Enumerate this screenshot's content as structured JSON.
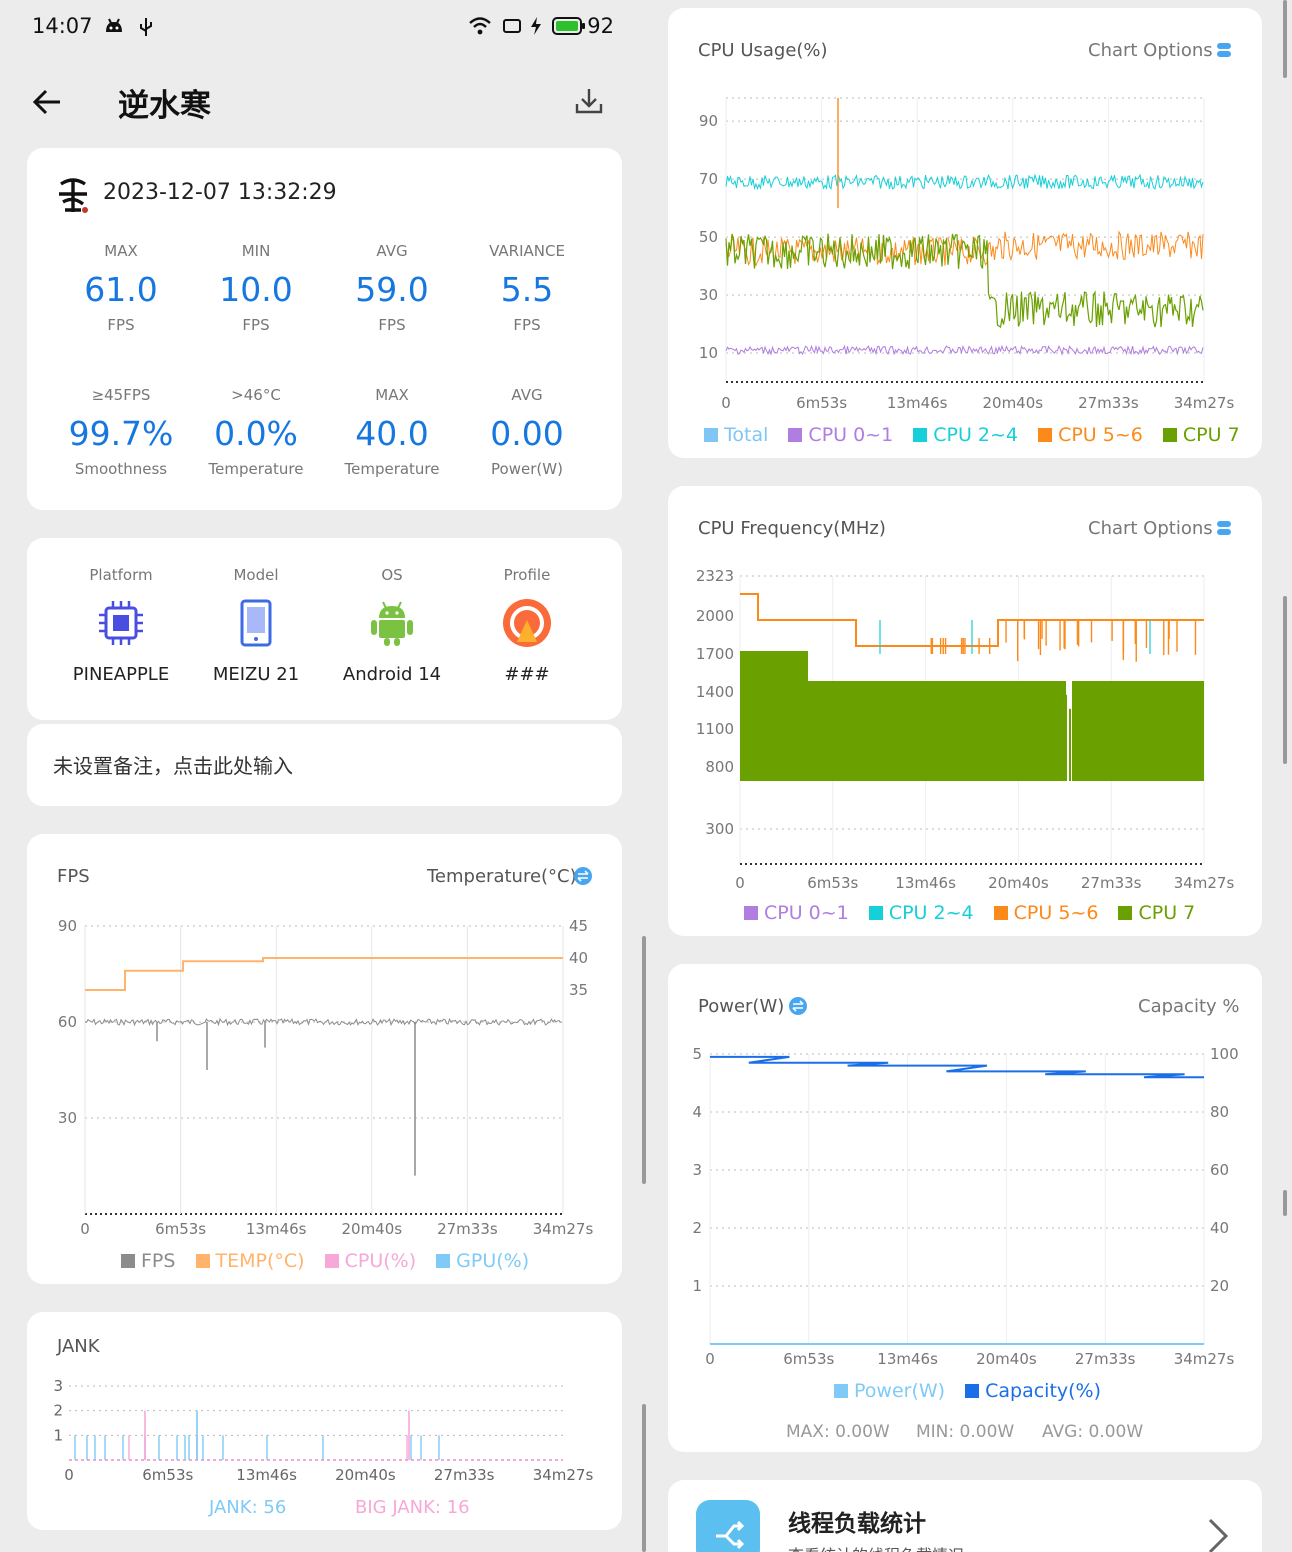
{
  "status_bar": {
    "time": "14:07",
    "battery": "92"
  },
  "header": {
    "title": "逆水寒"
  },
  "summary": {
    "datetime": "2023-12-07 13:32:29",
    "stats": [
      {
        "label": "MAX",
        "value": "61.0",
        "unit": "FPS"
      },
      {
        "label": "MIN",
        "value": "10.0",
        "unit": "FPS"
      },
      {
        "label": "AVG",
        "value": "59.0",
        "unit": "FPS"
      },
      {
        "label": "VARIANCE",
        "value": "5.5",
        "unit": "FPS"
      },
      {
        "label": "≥45FPS",
        "value": "99.7%",
        "unit": "Smoothness"
      },
      {
        "label": ">46°C",
        "value": "0.0%",
        "unit": "Temperature"
      },
      {
        "label": "MAX",
        "value": "40.0",
        "unit": "Temperature"
      },
      {
        "label": "AVG",
        "value": "0.00",
        "unit": "Power(W)"
      }
    ]
  },
  "device": {
    "items": [
      {
        "label": "Platform",
        "name": "PINEAPPLE",
        "icon": "chip-icon"
      },
      {
        "label": "Model",
        "name": "MEIZU 21",
        "icon": "phone-icon"
      },
      {
        "label": "OS",
        "name": "Android 14",
        "icon": "android-icon"
      },
      {
        "label": "Profile",
        "name": "###",
        "icon": "profile-icon"
      }
    ]
  },
  "note": {
    "text": "未设置备注，点击此处输入"
  },
  "fps_chart": {
    "left_title": "FPS",
    "right_title": "Temperature(°C)",
    "y_ticks": [
      "90",
      "60",
      "30"
    ],
    "y2_ticks": [
      "45",
      "40",
      "35"
    ],
    "x_ticks": [
      "0",
      "6m53s",
      "13m46s",
      "20m40s",
      "27m33s",
      "34m27s"
    ],
    "legend": [
      {
        "label": "FPS",
        "color": "#8c8c8c"
      },
      {
        "label": "TEMP(°C)",
        "color": "#ffb36b"
      },
      {
        "label": "CPU(%)",
        "color": "#f7a8d8"
      },
      {
        "label": "GPU(%)",
        "color": "#7fcaf7"
      }
    ]
  },
  "jank_chart": {
    "title": "JANK",
    "y_ticks": [
      "3",
      "2",
      "1"
    ],
    "x_ticks": [
      "0",
      "6m53s",
      "13m46s",
      "20m40s",
      "27m33s",
      "34m27s"
    ],
    "jank_label": "JANK: 56",
    "big_jank_label": "BIG JANK: 16"
  },
  "cpu_usage": {
    "title": "CPU Usage(%)",
    "options": "Chart Options",
    "y_ticks": [
      "90",
      "70",
      "50",
      "30",
      "10"
    ],
    "x_ticks": [
      "0",
      "6m53s",
      "13m46s",
      "20m40s",
      "27m33s",
      "34m27s"
    ],
    "legend": [
      {
        "label": "Total",
        "color": "#7fc6f5"
      },
      {
        "label": "CPU 0~1",
        "color": "#b07de0"
      },
      {
        "label": "CPU 2~4",
        "color": "#16cfd8"
      },
      {
        "label": "CPU 5~6",
        "color": "#fb8a1a"
      },
      {
        "label": "CPU 7",
        "color": "#6aa000"
      }
    ]
  },
  "cpu_freq": {
    "title": "CPU Frequency(MHz)",
    "options": "Chart Options",
    "y_ticks": [
      "2323",
      "2000",
      "1700",
      "1400",
      "1100",
      "800",
      "300"
    ],
    "x_ticks": [
      "0",
      "6m53s",
      "13m46s",
      "20m40s",
      "27m33s",
      "34m27s"
    ],
    "legend": [
      {
        "label": "CPU 0~1",
        "color": "#b07de0"
      },
      {
        "label": "CPU 2~4",
        "color": "#16cfd8"
      },
      {
        "label": "CPU 5~6",
        "color": "#fb8a1a"
      },
      {
        "label": "CPU 7",
        "color": "#6aa000"
      }
    ]
  },
  "power": {
    "title": "Power(W)",
    "right_title": "Capacity %",
    "y_ticks": [
      "5",
      "4",
      "3",
      "2",
      "1"
    ],
    "y2_ticks": [
      "100",
      "80",
      "60",
      "40",
      "20"
    ],
    "x_ticks": [
      "0",
      "6m53s",
      "13m46s",
      "20m40s",
      "27m33s",
      "34m27s"
    ],
    "legend": [
      {
        "label": "Power(W)",
        "color": "#7fcaf7"
      },
      {
        "label": "Capacity(%)",
        "color": "#1a6fe8"
      }
    ],
    "max": "MAX: 0.00W",
    "min": "MIN: 0.00W",
    "avg": "AVG: 0.00W"
  },
  "thread": {
    "title": "线程负载统计",
    "subtitle": "查看统计的线程负载情况"
  },
  "chart_data": [
    {
      "type": "line",
      "title": "FPS",
      "x": [
        "0",
        "6m53s",
        "13m46s",
        "20m40s",
        "27m33s",
        "34m27s"
      ],
      "series": [
        {
          "name": "FPS",
          "values": [
            60,
            59,
            60,
            60,
            60,
            60
          ]
        },
        {
          "name": "TEMP(°C)",
          "values": [
            35,
            38,
            40,
            40,
            40,
            40
          ]
        }
      ],
      "ylim": [
        0,
        90
      ],
      "y2lim": [
        30,
        45
      ]
    },
    {
      "type": "bar",
      "title": "JANK",
      "ylim": [
        0,
        3
      ]
    },
    {
      "type": "line",
      "title": "CPU Usage(%)",
      "x": [
        "0",
        "6m53s",
        "13m46s",
        "20m40s",
        "27m33s",
        "34m27s"
      ],
      "series": [
        {
          "name": "CPU 0~1",
          "values": [
            12,
            12,
            11,
            11,
            11,
            11
          ]
        },
        {
          "name": "CPU 2~4",
          "values": [
            68,
            70,
            69,
            68,
            69,
            70
          ]
        },
        {
          "name": "CPU 5~6",
          "values": [
            45,
            48,
            40,
            47,
            45,
            47
          ]
        },
        {
          "name": "CPU 7",
          "values": [
            40,
            45,
            45,
            25,
            22,
            22
          ]
        }
      ],
      "ylim": [
        0,
        100
      ]
    },
    {
      "type": "line",
      "title": "CPU Frequency(MHz)",
      "x": [
        "0",
        "6m53s",
        "13m46s",
        "20m40s",
        "27m33s",
        "34m27s"
      ],
      "series": [
        {
          "name": "CPU 5~6",
          "values": [
            2200,
            2150,
            1950,
            1950,
            2150,
            2150
          ]
        },
        {
          "name": "CPU 7",
          "values": [
            1700,
            1450,
            1450,
            1450,
            1450,
            1450
          ]
        }
      ],
      "ylim": [
        0,
        2323
      ]
    },
    {
      "type": "line",
      "title": "Power(W)",
      "x": [
        "0",
        "6m53s",
        "13m46s",
        "20m40s",
        "27m33s",
        "34m27s"
      ],
      "series": [
        {
          "name": "Power(W)",
          "values": [
            0,
            0,
            0,
            0,
            0,
            0
          ]
        },
        {
          "name": "Capacity(%)",
          "values": [
            99,
            97,
            96,
            94,
            93,
            92
          ]
        }
      ],
      "ylim": [
        0,
        5
      ],
      "y2lim": [
        0,
        100
      ]
    }
  ]
}
